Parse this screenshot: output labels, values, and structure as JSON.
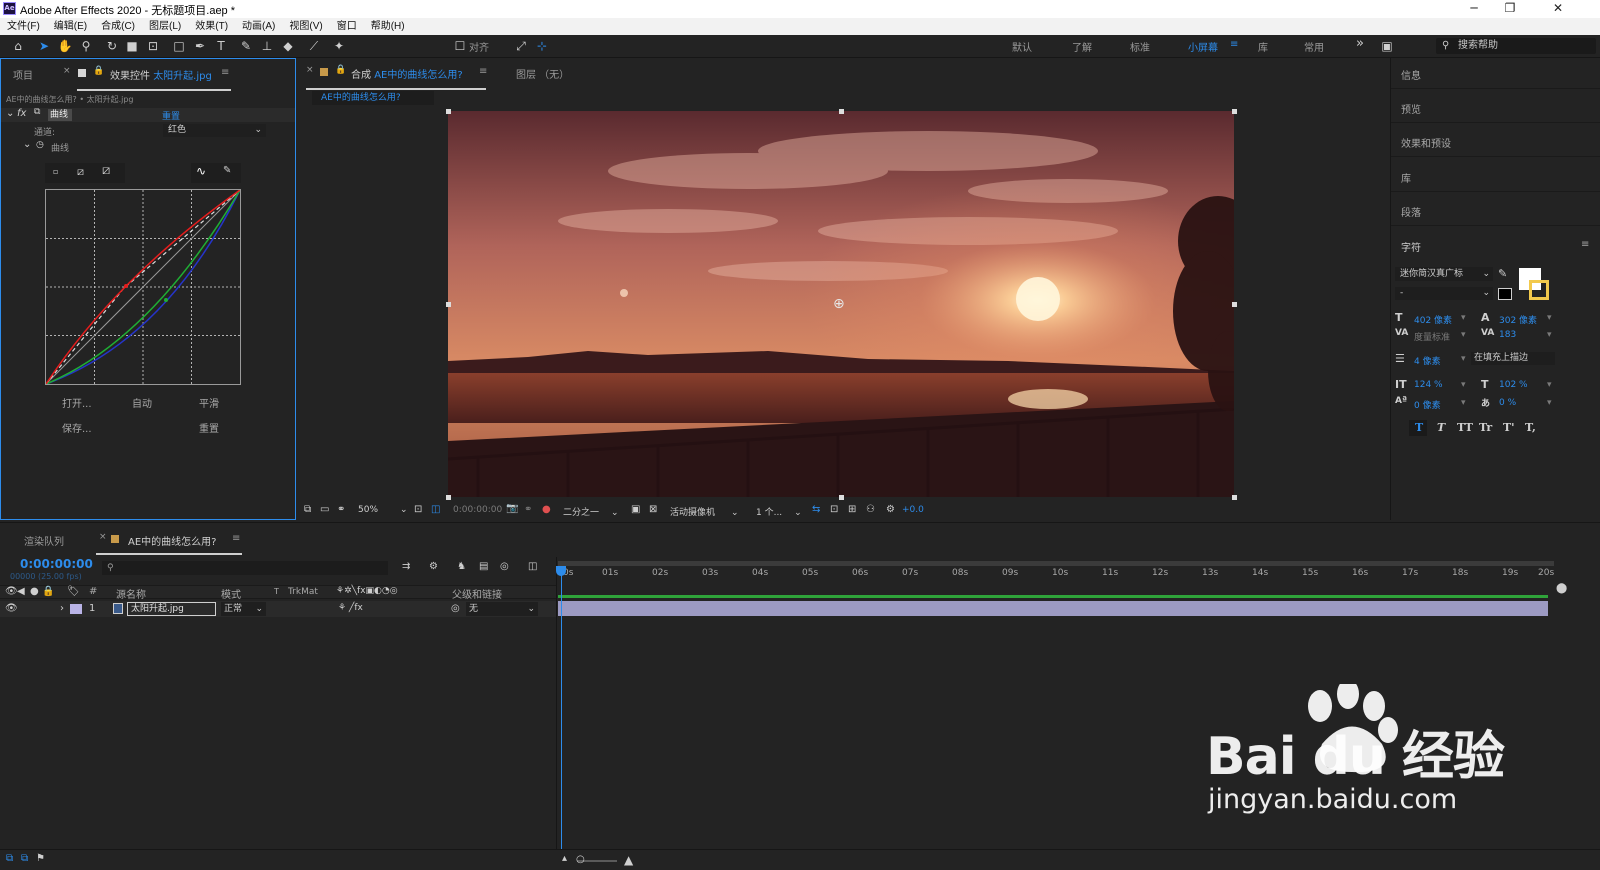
{
  "window": {
    "app_icon": "Ae",
    "title": "Adobe After Effects 2020 - 无标题项目.aep *",
    "controls": [
      "─",
      "❐",
      "✕"
    ]
  },
  "menu": [
    "文件(F)",
    "编辑(E)",
    "合成(C)",
    "图层(L)",
    "效果(T)",
    "动画(A)",
    "视图(V)",
    "窗口",
    "帮助(H)"
  ],
  "toolbar": {
    "align_label": "对齐",
    "workspaces": [
      "默认",
      "了解",
      "标准",
      "小屏幕",
      "库",
      "常用"
    ],
    "active_workspace": "小屏幕",
    "more": "»",
    "search_placeholder": "搜索帮助"
  },
  "effect_panel": {
    "tab_project": "项目",
    "tab_effects_prefix": "效果控件",
    "tab_effects_layer": "太阳升起.jpg",
    "breadcrumb": "AE中的曲线怎么用? • 太阳升起.jpg",
    "fx_label": "fx",
    "effect_name": "曲线",
    "reset": "重置",
    "channel_label": "通道:",
    "channel_value": "红色",
    "curves_label": "曲线",
    "buttons": {
      "open": "打开...",
      "auto": "自动",
      "smooth": "平滑",
      "save": "保存...",
      "reset": "重置"
    }
  },
  "comp_panel": {
    "tab_comp": "合成",
    "tab_comp_name": "AE中的曲线怎么用?",
    "tab_layer": "图层 （无）",
    "subtab": "AE中的曲线怎么用?",
    "zoom": "50%",
    "timecode": "0:00:00:00",
    "resolution": "二分之一",
    "camera": "活动摄像机",
    "views": "1 个...",
    "exposure": "+0.0"
  },
  "right_panel": {
    "items": [
      "信息",
      "预览",
      "效果和预设",
      "库",
      "段落",
      "字符"
    ],
    "font_family": "迷你简汉真广标",
    "font_style": "-",
    "font_size": "402 像素",
    "leading": "302 像素",
    "kerning": "度量标准",
    "tracking": "183",
    "stroke_width": "4 像素",
    "stroke_type": "在填充上描边",
    "vscale": "124 %",
    "hscale": "102 %",
    "baseline": "0 像素",
    "tsume": "0 %",
    "styles": [
      "T",
      "T",
      "TT",
      "Tr",
      "T'",
      "T,"
    ],
    "colors": {
      "fill": "#ffffff",
      "stroke": "#000000",
      "accent": "#f2c94c"
    }
  },
  "timeline": {
    "tab_render": "渲染队列",
    "tab_comp": "AE中的曲线怎么用?",
    "timecode": "0:00:00:00",
    "fps": "00000 (25.00 fps)",
    "search_placeholder": "",
    "col_source": "源名称",
    "col_mode": "模式",
    "col_t": "T",
    "col_trkmat": "TrkMat",
    "col_parent": "父级和链接",
    "col_num": "#",
    "layer": {
      "num": "1",
      "name": "太阳升起.jpg",
      "mode": "正常",
      "parent": "无"
    },
    "ruler": [
      "0s",
      "01s",
      "02s",
      "03s",
      "04s",
      "05s",
      "06s",
      "07s",
      "08s",
      "09s",
      "10s",
      "11s",
      "12s",
      "13s",
      "14s",
      "15s",
      "16s",
      "17s",
      "18s",
      "19s",
      "20s"
    ]
  },
  "watermark": {
    "brand": "Bai du 经验",
    "url": "jingyan.baidu.com"
  }
}
